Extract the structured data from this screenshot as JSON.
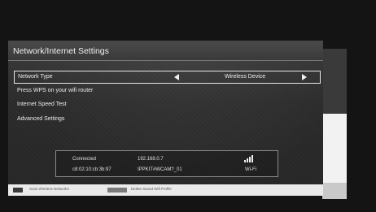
{
  "dialog": {
    "title": "Network/Internet Settings"
  },
  "menu": {
    "items": [
      {
        "label": "Network Type",
        "value": "Wireless Device"
      },
      {
        "label": "Press WPS on your wifi router"
      },
      {
        "label": "Internet Speed Test"
      },
      {
        "label": "Advanced Settings"
      }
    ]
  },
  "status": {
    "state": "Connected",
    "mac": "c8:02:10:cb:3b:97",
    "ip": "192.168.0.7",
    "ssid": "IPPKIT#WCAM?_01",
    "connection_type": "Wi-Fi",
    "signal_icon": "wifi-signal-icon"
  },
  "legend": {
    "scan_label": "Scan Wireless Networks",
    "delete_label": "Delete Saved Wifi Profile"
  },
  "colors": {
    "background": "#141414",
    "dialog": "#2b2b2b",
    "text": "#f0f0f0",
    "legend_bar": "#eaeaea"
  }
}
